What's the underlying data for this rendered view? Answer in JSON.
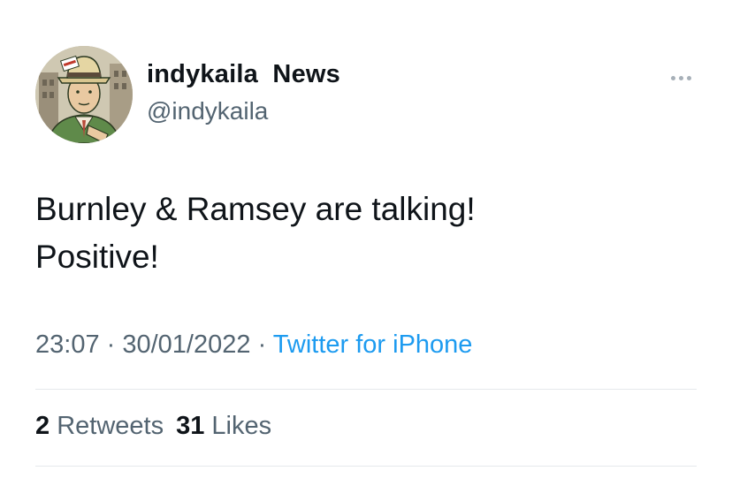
{
  "author": {
    "display_name": "indykaila  News",
    "handle": "@indykaila",
    "avatar_icon": "newspaper-reporter-avatar-icon"
  },
  "menu_icon": "more-dots-icon",
  "tweet": {
    "line1": "Burnley & Ramsey are talking!",
    "line2": "Positive!"
  },
  "meta": {
    "time": "23:07",
    "separator": " · ",
    "date": "30/01/2022",
    "source": "Twitter for iPhone"
  },
  "stats": {
    "retweets_count": "2",
    "retweets_label": "Retweets",
    "likes_count": "31",
    "likes_label": "Likes"
  },
  "colors": {
    "text": "#0f1419",
    "secondary": "#536471",
    "link": "#1d9bf0",
    "divider": "#e6e9ec"
  }
}
